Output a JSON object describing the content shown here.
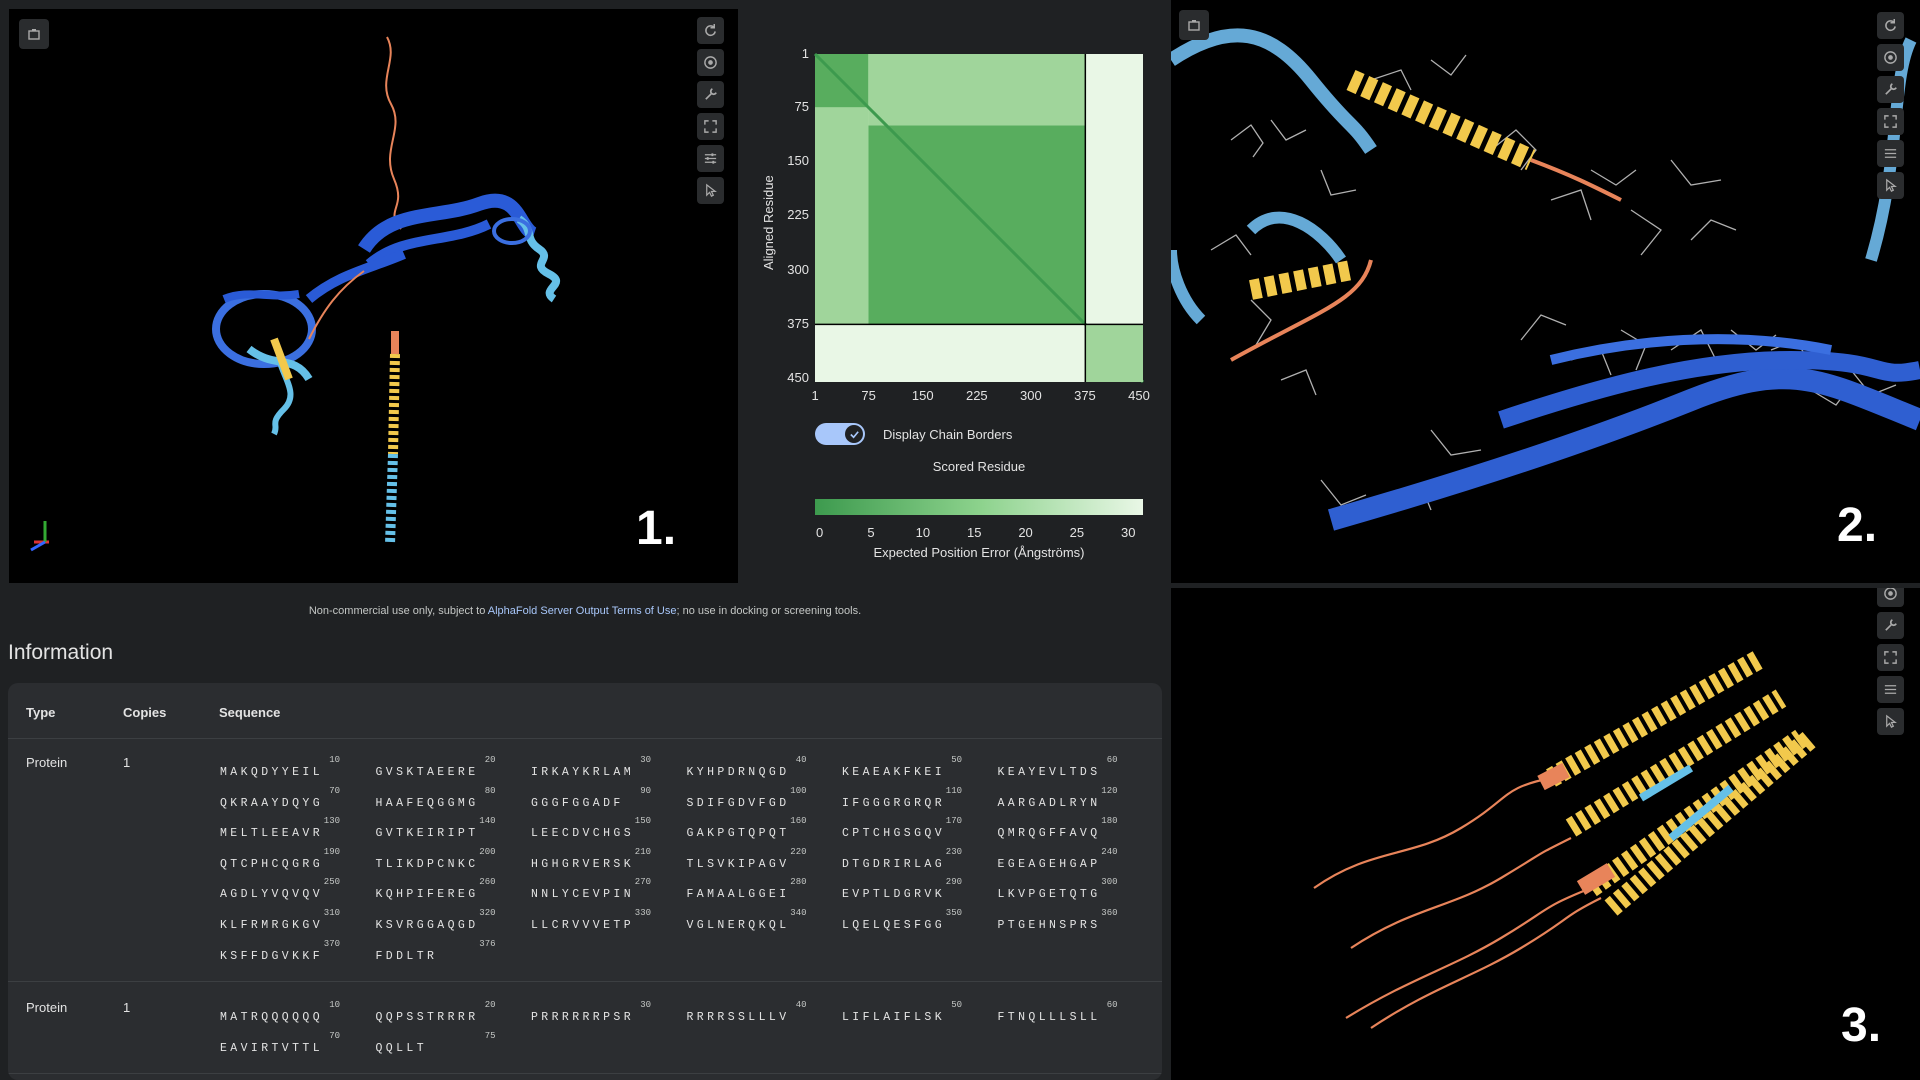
{
  "panels": {
    "label1": "1.",
    "label2": "2.",
    "label3": "3."
  },
  "pae": {
    "ylabel": "Aligned Residue",
    "y_ticks": [
      "1",
      "75",
      "150",
      "225",
      "300",
      "375",
      "450"
    ],
    "x_ticks": [
      "1",
      "75",
      "150",
      "225",
      "300",
      "375",
      "450"
    ],
    "toggle_label": "Display Chain Borders",
    "toggle_on": true,
    "scored_label": "Scored Residue",
    "colorbar_ticks": [
      "0",
      "5",
      "10",
      "15",
      "20",
      "25",
      "30"
    ],
    "colorbar_label": "Expected Position Error (Ångströms)",
    "colors": {
      "low": "#3d9a4e",
      "high": "#e9f7e6"
    }
  },
  "chart_data": {
    "type": "heatmap",
    "title": "",
    "ylabel": "Aligned Residue",
    "xlabel": "Scored Residue",
    "xlim": [
      1,
      456
    ],
    "ylim": [
      1,
      456
    ],
    "chain_border": 376,
    "value_range": [
      0,
      30
    ],
    "value_label": "Expected Position Error (Ångströms)"
  },
  "footnote": {
    "prefix": "Non-commercial use only, subject to ",
    "link": "AlphaFold Server Output Terms of Use",
    "suffix": "; no use in docking or screening tools."
  },
  "info": {
    "title": "Information",
    "headers": {
      "type": "Type",
      "copies": "Copies",
      "sequence": "Sequence"
    },
    "entities": [
      {
        "type": "Protein",
        "copies": "1",
        "chunks": [
          [
            "10",
            "MAKQDYYEIL"
          ],
          [
            "20",
            "GVSKTAEERE"
          ],
          [
            "30",
            "IRKAYKRLAM"
          ],
          [
            "40",
            "KYHPDRNQGD"
          ],
          [
            "50",
            "KEAEAKFKEI"
          ],
          [
            "60",
            "KEAYEVLTDS"
          ],
          [
            "70",
            "QKRAAYDQYG"
          ],
          [
            "80",
            "HAAFEQGGMG"
          ],
          [
            "90",
            "GGGFGGADF"
          ],
          [
            "100",
            "SDIFGDVFGD"
          ],
          [
            "110",
            "IFGGGRGRQR"
          ],
          [
            "120",
            "AARGADLRYN"
          ],
          [
            "130",
            "MELTLEEAVR"
          ],
          [
            "140",
            "GVTKEIRIPT"
          ],
          [
            "150",
            "LEECDVCHGS"
          ],
          [
            "160",
            "GAKPGTQPQT"
          ],
          [
            "170",
            "CPTCHGSGQV"
          ],
          [
            "180",
            "QMRQGFFAVQ"
          ],
          [
            "190",
            "QTCPHCQGRG"
          ],
          [
            "200",
            "TLIKDPCNKC"
          ],
          [
            "210",
            "HGHGRVERSK"
          ],
          [
            "220",
            "TLSVKIPAGV"
          ],
          [
            "230",
            "DTGDRIRLAG"
          ],
          [
            "240",
            "EGEAGEHGAP"
          ],
          [
            "250",
            "AGDLYVQVQV"
          ],
          [
            "260",
            "KQHPIFEREG"
          ],
          [
            "270",
            "NNLYCEVPIN"
          ],
          [
            "280",
            "FAMAALGGEI"
          ],
          [
            "290",
            "EVPTLDGRVK"
          ],
          [
            "300",
            "LKVPGETQTG"
          ],
          [
            "310",
            "KLFRMRGKGV"
          ],
          [
            "320",
            "KSVRGGAQGD"
          ],
          [
            "330",
            "LLCRVVVETP"
          ],
          [
            "340",
            "VGLNERQKQL"
          ],
          [
            "350",
            "LQELQESFGG"
          ],
          [
            "360",
            "PTGEHNSPRS"
          ],
          [
            "370",
            "KSFFDGVKKF"
          ],
          [
            "376",
            "FDDLTR"
          ]
        ]
      },
      {
        "type": "Protein",
        "copies": "1",
        "chunks": [
          [
            "10",
            "MATRQQQQQQ"
          ],
          [
            "20",
            "QQPSSTRRRR"
          ],
          [
            "30",
            "PRRRRRRPSR"
          ],
          [
            "40",
            "RRRRSSLLLV"
          ],
          [
            "50",
            "LIFLAIFLSK"
          ],
          [
            "60",
            "FTNQLLLSLL"
          ],
          [
            "70",
            "EAVIRTVTTL"
          ],
          [
            "75",
            "QQLLT"
          ]
        ]
      }
    ]
  },
  "tools": {
    "viewer_icons": [
      "rotate-icon",
      "center-icon",
      "wrench-icon",
      "fullscreen-icon",
      "sliders-icon",
      "pointer-icon"
    ],
    "corner_icon": "screenshot-icon"
  }
}
